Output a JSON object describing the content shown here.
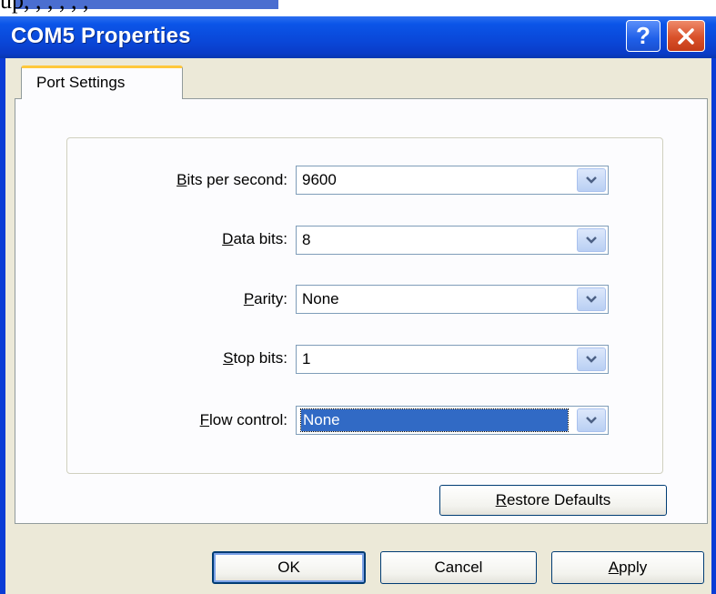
{
  "background": {
    "text": "up,   , ,            ,   ,         ,"
  },
  "window": {
    "title": "COM5 Properties",
    "help_icon_text": "?",
    "colors": {
      "titlebar": "#0a47d8",
      "client": "#ece9d8",
      "selection": "#316ac5"
    }
  },
  "tabs": [
    {
      "label": "Port Settings",
      "active": true
    }
  ],
  "fields": {
    "bits_per_second": {
      "label_accel": "B",
      "label_rest": "its per second:",
      "value": "9600"
    },
    "data_bits": {
      "label_accel": "D",
      "label_rest": "ata bits:",
      "value": "8"
    },
    "parity": {
      "label_accel": "P",
      "label_rest": "arity:",
      "value": "None"
    },
    "stop_bits": {
      "label_accel": "S",
      "label_rest": "top bits:",
      "value": "1"
    },
    "flow_control": {
      "label_accel": "F",
      "label_rest": "low control:",
      "value": "None"
    }
  },
  "buttons": {
    "restore_accel": "R",
    "restore_rest": "estore Defaults",
    "ok": "OK",
    "cancel": "Cancel",
    "apply_accel": "A",
    "apply_rest": "pply"
  }
}
